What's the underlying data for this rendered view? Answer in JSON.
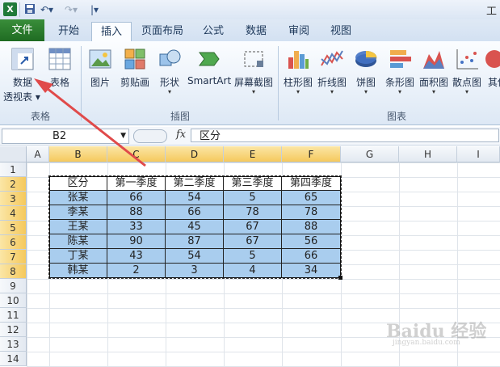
{
  "titlebar": {
    "title_partial": "工"
  },
  "tabs": [
    "文件",
    "开始",
    "插入",
    "页面布局",
    "公式",
    "数据",
    "审阅",
    "视图"
  ],
  "ribbon": {
    "pivot_line1": "数据",
    "pivot_line2": "透视表",
    "table": "表格",
    "picture": "图片",
    "clipart": "剪贴画",
    "shapes": "形状",
    "smartart": "SmartArt",
    "screenshot": "屏幕截图",
    "column_chart": "柱形图",
    "line_chart": "折线图",
    "pie_chart": "饼图",
    "bar_chart": "条形图",
    "area_chart": "面积图",
    "scatter_chart": "散点图",
    "other_chart": "其他",
    "groups": {
      "tables": "表格",
      "illustrations": "插图",
      "charts": "图表"
    }
  },
  "formula_bar": {
    "name_box": "B2",
    "fx": "fx",
    "content": "区分"
  },
  "columns": [
    "A",
    "B",
    "C",
    "D",
    "E",
    "F",
    "G",
    "H",
    "I"
  ],
  "rows": [
    "1",
    "2",
    "3",
    "4",
    "5",
    "6",
    "7",
    "8",
    "9",
    "10",
    "11",
    "12",
    "13",
    "14"
  ],
  "table": {
    "header": [
      "区分",
      "第一季度",
      "第二季度",
      "第三季度",
      "第四季度"
    ],
    "rows": [
      [
        "张某",
        "66",
        "54",
        "5",
        "65"
      ],
      [
        "李某",
        "88",
        "66",
        "78",
        "78"
      ],
      [
        "王某",
        "33",
        "45",
        "67",
        "88"
      ],
      [
        "陈某",
        "90",
        "87",
        "67",
        "56"
      ],
      [
        "丁某",
        "43",
        "54",
        "5",
        "66"
      ],
      [
        "韩某",
        "2",
        "3",
        "4",
        "34"
      ]
    ]
  },
  "colors": {
    "selection": "#a9cdee",
    "file_tab": "#2e7d32",
    "arrow": "#e04a4a"
  }
}
